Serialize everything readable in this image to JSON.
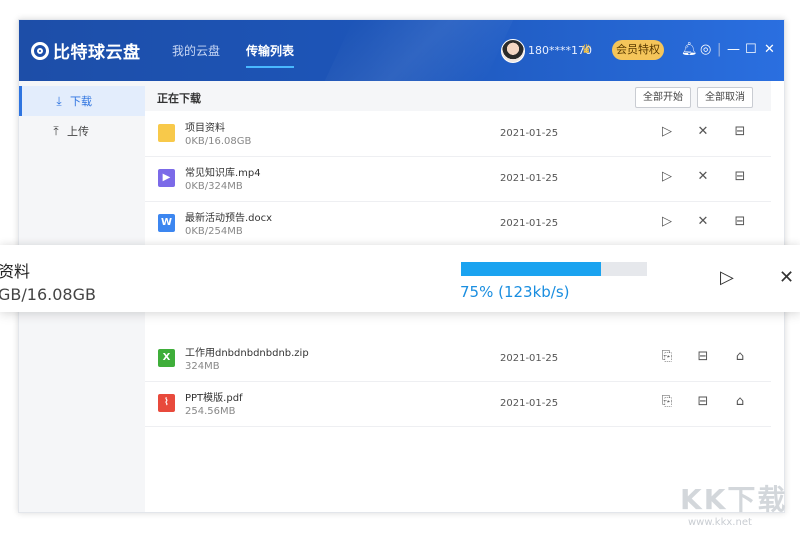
{
  "app": {
    "logo_text": "比特球云盘",
    "nav": [
      {
        "label": "我的云盘"
      },
      {
        "label": "传输列表"
      }
    ],
    "user": "180****170",
    "vip_button": "会员特权",
    "window_controls": {
      "minimize": "—",
      "maximize": "☐",
      "close": "✕"
    }
  },
  "sidebar": {
    "items": [
      {
        "label": "下载",
        "icon": "download-icon"
      },
      {
        "label": "上传",
        "icon": "upload-icon"
      }
    ]
  },
  "section": {
    "title": "正在下载",
    "start_all": "全部开始",
    "cancel_all": "全部取消"
  },
  "downloading": [
    {
      "name": "项目资料",
      "size": "0KB/16.08GB",
      "date": "2021-01-25",
      "type": "folder"
    },
    {
      "name": "常见知识库.mp4",
      "size": "0KB/324MB",
      "date": "2021-01-25",
      "type": "video"
    },
    {
      "name": "最新活动预告.docx",
      "size": "0KB/254MB",
      "date": "2021-01-25",
      "type": "word",
      "icon_letter": "W"
    }
  ],
  "completed": [
    {
      "name": "工作用dnbdnbdnbdnb.zip",
      "size": "324MB",
      "date": "2021-01-25",
      "type": "excel",
      "icon_letter": "X"
    },
    {
      "name": "PPT模版.pdf",
      "size": "254.56MB",
      "date": "2021-01-25",
      "type": "pdf"
    }
  ],
  "overlay": {
    "name": "资料",
    "size": "GB/16.08GB",
    "progress": 0.75,
    "progress_text": "75% (123kb/s)"
  },
  "watermark": {
    "text": "KK下载",
    "url": "www.kkx.net"
  },
  "colors": {
    "accent": "#2e74e0",
    "titlebar": "#1d4ea8",
    "progress": "#1aa3f0",
    "vip": "#f5c55a"
  }
}
